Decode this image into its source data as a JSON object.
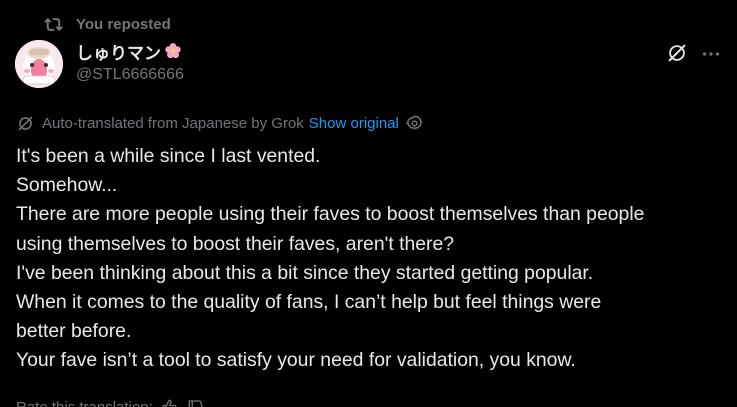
{
  "repost": {
    "label": "You reposted",
    "icon": "repost-icon"
  },
  "author": {
    "name": "しゅりマン",
    "name_emoji": "cherry-blossom-icon",
    "handle": "@STL6666666",
    "avatar": "avatar"
  },
  "actions": {
    "grok_icon": "grok-icon",
    "more_icon": "more-icon"
  },
  "translation": {
    "notice": "Auto-translated from Japanese by Grok",
    "show_original": "Show original",
    "settings_icon": "gear-icon"
  },
  "tweet": {
    "lines": [
      "It's been a while since I last vented.",
      "Somehow...",
      "There are more people using their faves to boost themselves than people",
      "using themselves to boost their faves, aren't there?",
      "I've been thinking about this a bit since they started getting popular.",
      "When it comes to the quality of fans, I can’t help but feel things were",
      "better before.",
      "Your fave isn’t a tool to satisfy your need for validation, you know."
    ]
  },
  "rating": {
    "label": "Rate this translation:"
  },
  "colors": {
    "background": "#000000",
    "text": "#e7e9ea",
    "muted": "#71767b",
    "link": "#1d9bf0"
  }
}
